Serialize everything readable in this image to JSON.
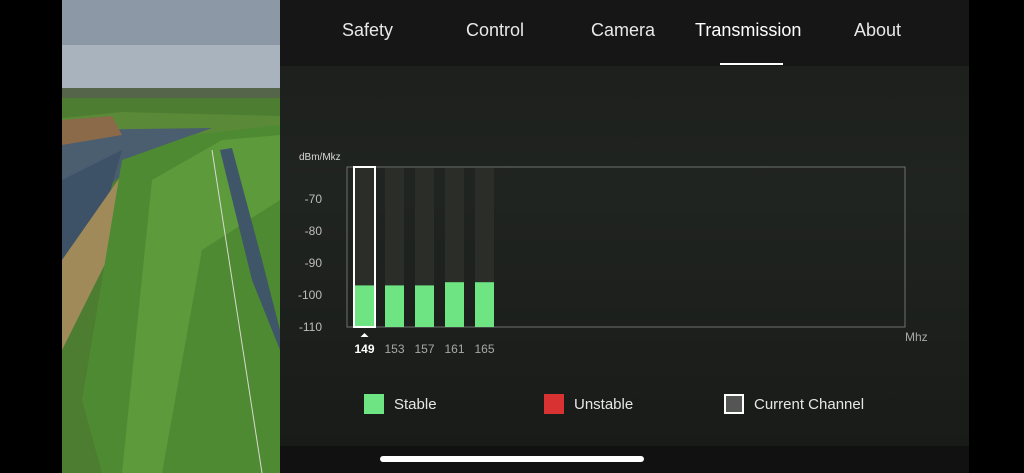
{
  "tabs": [
    {
      "label": "Safety"
    },
    {
      "label": "Control"
    },
    {
      "label": "Camera"
    },
    {
      "label": "Transmission",
      "active": true
    },
    {
      "label": "About"
    }
  ],
  "chart_data": {
    "type": "bar",
    "ylabel": "dBm/Mkz",
    "xlabel": "Mhz",
    "ylim": [
      -110,
      -60
    ],
    "yticks": [
      "-70",
      "-80",
      "-90",
      "-100",
      "-110"
    ],
    "categories": [
      "149",
      "153",
      "157",
      "161",
      "165"
    ],
    "values": [
      -97,
      -97,
      -97,
      -96,
      -96
    ],
    "current_channel": "149",
    "status": [
      "stable",
      "stable",
      "stable",
      "stable",
      "stable"
    ],
    "colors": {
      "stable": "#6ee582",
      "unstable": "#d83232",
      "current": "#ffffff",
      "column_bg": "#2a2d28"
    }
  },
  "legend": {
    "stable": "Stable",
    "unstable": "Unstable",
    "current": "Current Channel"
  }
}
